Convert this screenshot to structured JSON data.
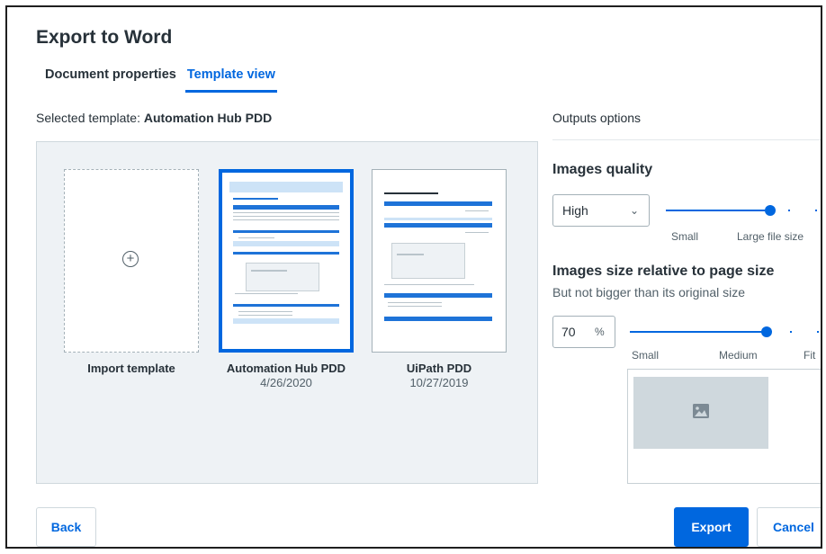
{
  "dialog": {
    "title": "Export to Word"
  },
  "tabs": [
    {
      "label": "Document properties",
      "active": false
    },
    {
      "label": "Template view",
      "active": true
    }
  ],
  "selected_template": {
    "prefix": "Selected template: ",
    "name": "Automation Hub PDD"
  },
  "templates": [
    {
      "name": "Import template",
      "date": "",
      "icon": "plus-circle-icon"
    },
    {
      "name": "Automation Hub PDD",
      "date": "4/26/2020",
      "selected": true
    },
    {
      "name": "UiPath PDD",
      "date": "10/27/2019"
    }
  ],
  "outputs": {
    "label": "Outputs options",
    "images_quality": {
      "heading": "Images quality",
      "selected": "High",
      "slider_level": 0.6,
      "labels": [
        "Small",
        "Large file size"
      ]
    },
    "images_size": {
      "heading": "Images size relative to page size",
      "subtitle": "But not bigger than its original size",
      "value": "70",
      "unit": "%",
      "slider_level": 0.7,
      "labels": [
        "Small",
        "Medium",
        "Fit"
      ]
    },
    "preview_icon": "image-icon"
  },
  "buttons": {
    "back": "Back",
    "export": "Export",
    "cancel": "Cancel"
  },
  "colors": {
    "accent": "#0067df",
    "gallery_bg": "#eef2f5"
  }
}
